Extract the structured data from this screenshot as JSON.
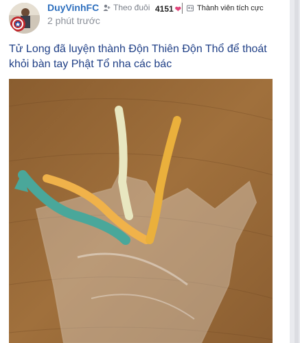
{
  "post": {
    "author": {
      "username": "DuyVinhFC",
      "follow_label": "Theo đuôi",
      "like_count": "4151",
      "rank_label": "Thành viên tích cực"
    },
    "timestamp": "2 phút trước",
    "body_text": "Tử Long đã luyện thành Độn Thiên Độn Thổ để thoát khỏi bàn tay Phật Tổ nha các bác"
  },
  "icons": {
    "follow": "person-add-icon",
    "like": "heart-icon",
    "rank": "member-badge-icon"
  },
  "colors": {
    "username": "#2d6fbe",
    "post_text": "#1f3f86",
    "heart": "#e0457b"
  }
}
